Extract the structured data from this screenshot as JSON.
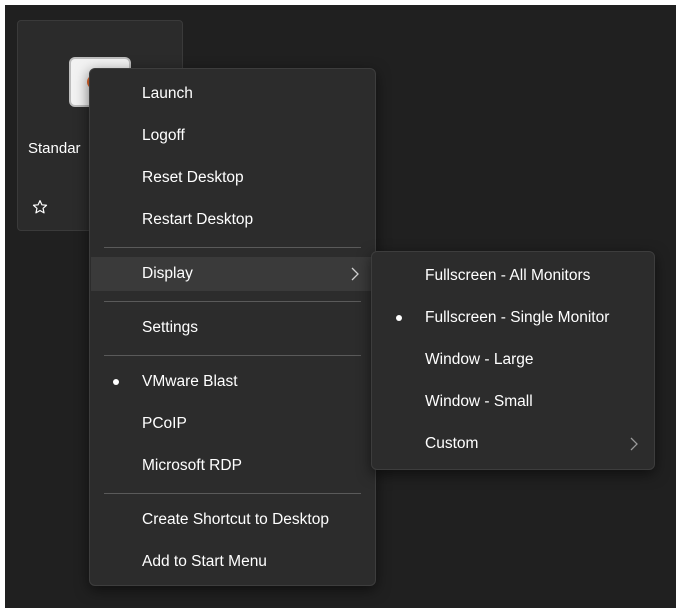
{
  "tile": {
    "name": "Standar",
    "icon": "app-icon",
    "favorite_icon": "star-outline-icon"
  },
  "menu": {
    "launch": "Launch",
    "logoff": "Logoff",
    "reset_desktop": "Reset Desktop",
    "restart_desktop": "Restart Desktop",
    "display": "Display",
    "settings": "Settings",
    "vmware_blast": "VMware Blast",
    "pcoip": "PCoIP",
    "microsoft_rdp": "Microsoft RDP",
    "create_shortcut": "Create Shortcut to Desktop",
    "add_to_start": "Add to Start Menu",
    "selected_protocol": "VMware Blast"
  },
  "display_submenu": {
    "fullscreen_all": "Fullscreen - All Monitors",
    "fullscreen_single": "Fullscreen - Single Monitor",
    "window_large": "Window - Large",
    "window_small": "Window - Small",
    "custom": "Custom",
    "selected": "Fullscreen - Single Monitor"
  },
  "colors": {
    "background": "#202020",
    "menu_bg": "#2c2c2c",
    "hover_bg": "#3a3a3a",
    "icon_accent": "#e8692c"
  }
}
